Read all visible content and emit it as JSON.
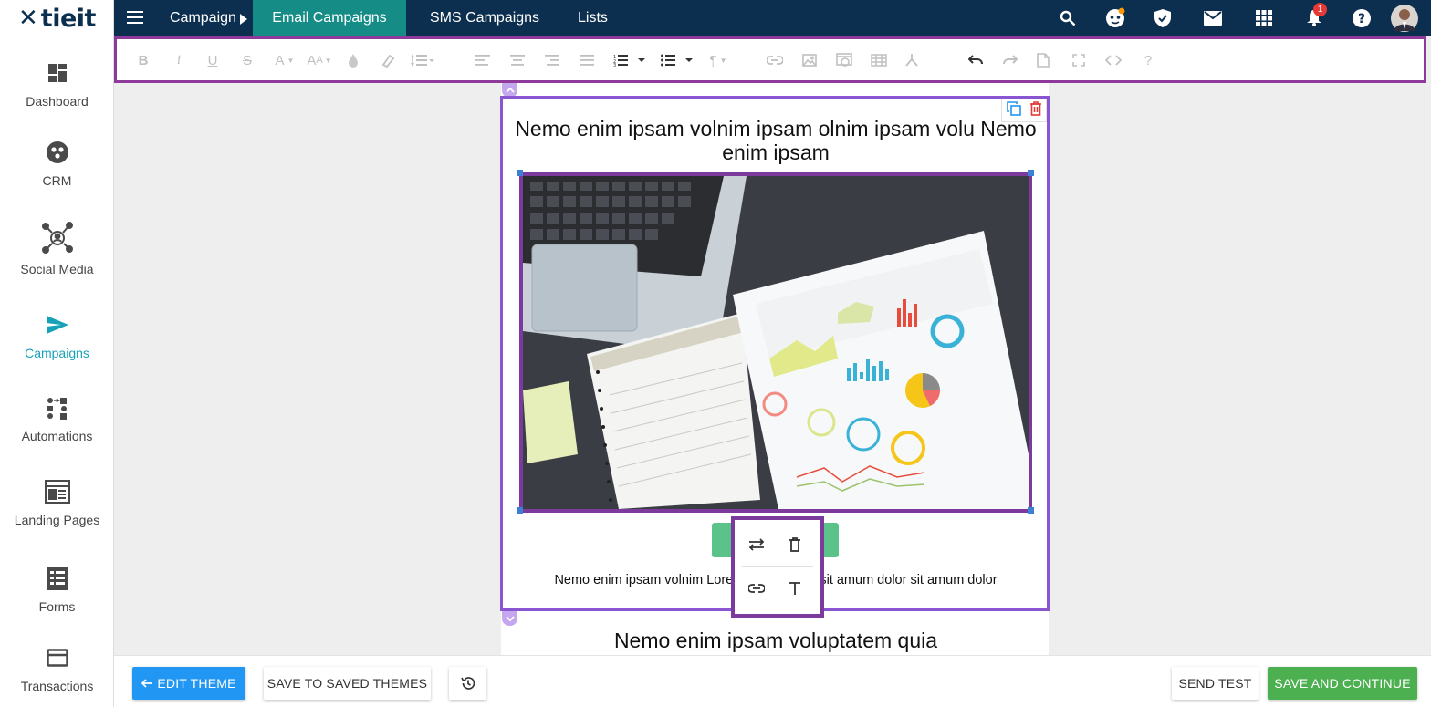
{
  "app": {
    "logo_text": "tieit"
  },
  "sidebar": {
    "items": [
      {
        "label": "Dashboard",
        "icon": "dashboard-icon",
        "active": false
      },
      {
        "label": "CRM",
        "icon": "crm-icon",
        "active": false
      },
      {
        "label": "Social Media",
        "icon": "social-media-icon",
        "active": false
      },
      {
        "label": "Campaigns",
        "icon": "send-icon",
        "active": true
      },
      {
        "label": "Automations",
        "icon": "automations-icon",
        "active": false
      },
      {
        "label": "Landing Pages",
        "icon": "landing-page-icon",
        "active": false
      },
      {
        "label": "Forms",
        "icon": "forms-icon",
        "active": false
      },
      {
        "label": "Transactions",
        "icon": "credit-card-icon",
        "active": false
      }
    ]
  },
  "topbar": {
    "breadcrumb_root": "Campaign",
    "tabs": [
      {
        "label": "Email Campaigns",
        "active": true
      },
      {
        "label": "SMS Campaigns",
        "active": false
      },
      {
        "label": "Lists",
        "active": false
      }
    ],
    "notification_count": "1",
    "icons": [
      "search-icon",
      "bot-icon",
      "shield-icon",
      "mail-icon",
      "apps-grid-icon",
      "bell-icon",
      "help-icon",
      "avatar"
    ]
  },
  "email": {
    "heading": "Nemo enim ipsam volnim ipsam olnim ipsam volu Nemo enim ipsam",
    "paragraph": "Nemo enim ipsam volnim Lorem ipsum dolor sit amum dolor sit amum dolor",
    "heading2": "Nemo enim ipsam voluptatem quia"
  },
  "footer": {
    "edit_theme": "EDIT THEME",
    "save_themes": "SAVE TO SAVED THEMES",
    "send_test": "SEND TEST",
    "save_continue": "SAVE AND CONTINUE"
  },
  "colors": {
    "topbar": "#0d2f4f",
    "active_tab": "#168c86",
    "accent": "#17a2b8",
    "selection": "#8a55d0",
    "image_outline": "#7b3a9c",
    "primary_button": "#2196f3",
    "success_button": "#4caf50"
  }
}
